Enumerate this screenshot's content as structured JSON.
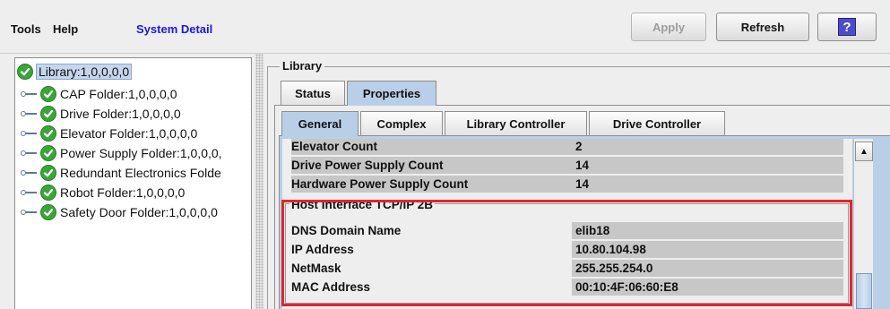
{
  "menu": {
    "tools": "Tools",
    "help": "Help",
    "system_detail": "System Detail"
  },
  "toolbar": {
    "apply_label": "Apply",
    "refresh_label": "Refresh",
    "help_glyph": "?"
  },
  "tree": {
    "root": "Library:1,0,0,0,0",
    "children": [
      "CAP Folder:1,0,0,0,0",
      "Drive Folder:1,0,0,0,0",
      "Elevator Folder:1,0,0,0,0",
      "Power Supply Folder:1,0,0,0,",
      "Redundant Electronics Folde",
      "Robot Folder:1,0,0,0,0",
      "Safety Door Folder:1,0,0,0,0"
    ]
  },
  "panel": {
    "title": "Library",
    "tabs": [
      "Status",
      "Properties"
    ],
    "subtabs": [
      "General",
      "Complex",
      "Library Controller",
      "Drive Controller"
    ]
  },
  "properties": {
    "top_rows": [
      {
        "label": "Elevator Count",
        "value": "2"
      },
      {
        "label": "Drive Power Supply Count",
        "value": "14"
      },
      {
        "label": "Hardware Power Supply Count",
        "value": "14"
      }
    ],
    "host_group": {
      "title": "Host Interface TCP/IP 2B",
      "rows": [
        {
          "label": "DNS Domain Name",
          "value": "elib18"
        },
        {
          "label": "IP Address",
          "value": "10.80.104.98"
        },
        {
          "label": "NetMask",
          "value": "255.255.254.0"
        },
        {
          "label": "MAC Address",
          "value": "00:10:4F:06:60:E8"
        }
      ]
    }
  },
  "colors": {
    "link_blue": "#1a1ad6",
    "highlight_red": "#e0262d",
    "status_green": "#3aa63a",
    "selected_tab": "#b9cfe8"
  }
}
